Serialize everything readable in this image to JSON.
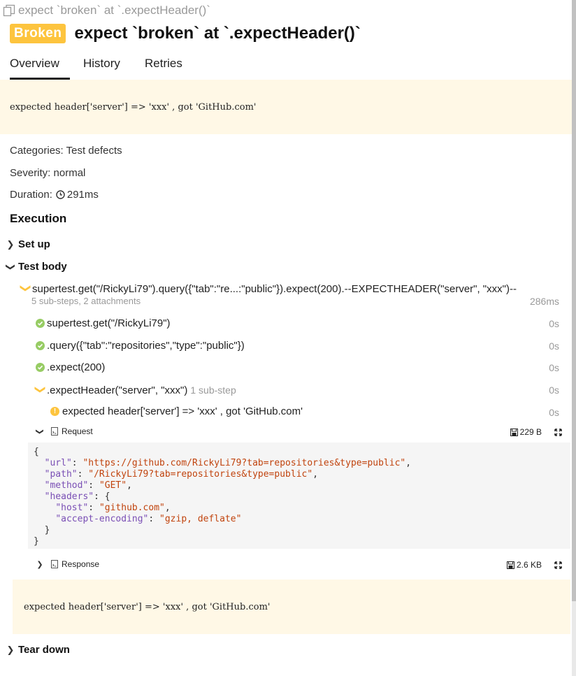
{
  "breadcrumb": {
    "text": "expect `broken` at `.expectHeader()`"
  },
  "header": {
    "status_badge": "Broken",
    "title": "expect `broken` at `.expectHeader()`"
  },
  "tabs": [
    {
      "label": "Overview"
    },
    {
      "label": "History"
    },
    {
      "label": "Retries"
    }
  ],
  "error_message": "expected header['server'] => 'xxx' , got 'GitHub.com'",
  "meta": {
    "categories_label": "Categories:",
    "categories_value": "Test defects",
    "severity_label": "Severity:",
    "severity_value": "normal",
    "duration_label": "Duration:",
    "duration_value": "291ms"
  },
  "execution": {
    "title": "Execution",
    "setup_label": "Set up",
    "body_label": "Test body",
    "teardown_label": "Tear down",
    "main_step": {
      "label": "supertest.get(\"/RickyLi79\").query({\"tab\":\"re...:\"public\"}).expect(200).--EXPECTHEADER(\"server\", \"xxx\")--",
      "summary": "5 sub-steps, 2 attachments",
      "time": "286ms"
    },
    "steps": [
      {
        "label": "supertest.get(\"/RickyLi79\")",
        "time": "0s"
      },
      {
        "label": ".query({\"tab\":\"repositories\",\"type\":\"public\"})",
        "time": "0s"
      },
      {
        "label": ".expect(200)",
        "time": "0s"
      },
      {
        "label": ".expectHeader(\"server\", \"xxx\")",
        "sub": "1 sub-step",
        "time": "0s"
      }
    ],
    "nested_step": {
      "label": "expected header['server'] => 'xxx' , got 'GitHub.com'",
      "time": "0s"
    },
    "attachments": [
      {
        "name": "Request",
        "size": "229 B"
      },
      {
        "name": "Response",
        "size": "2.6 KB"
      }
    ],
    "request_body": {
      "url_key": "\"url\"",
      "url_val": "\"https://github.com/RickyLi79?tab=repositories&type=public\"",
      "path_key": "\"path\"",
      "path_val": "\"/RickyLi79?tab=repositories&type=public\"",
      "method_key": "\"method\"",
      "method_val": "\"GET\"",
      "headers_key": "\"headers\"",
      "host_key": "\"host\"",
      "host_val": "\"github.com\"",
      "enc_key": "\"accept-encoding\"",
      "enc_val": "\"gzip, deflate\""
    },
    "step_error": "expected header['server'] => 'xxx' , got 'GitHub.com'"
  },
  "colors": {
    "broken": "#fdc43e",
    "passed": "#97cc64",
    "error_bg": "#fff8e6"
  }
}
